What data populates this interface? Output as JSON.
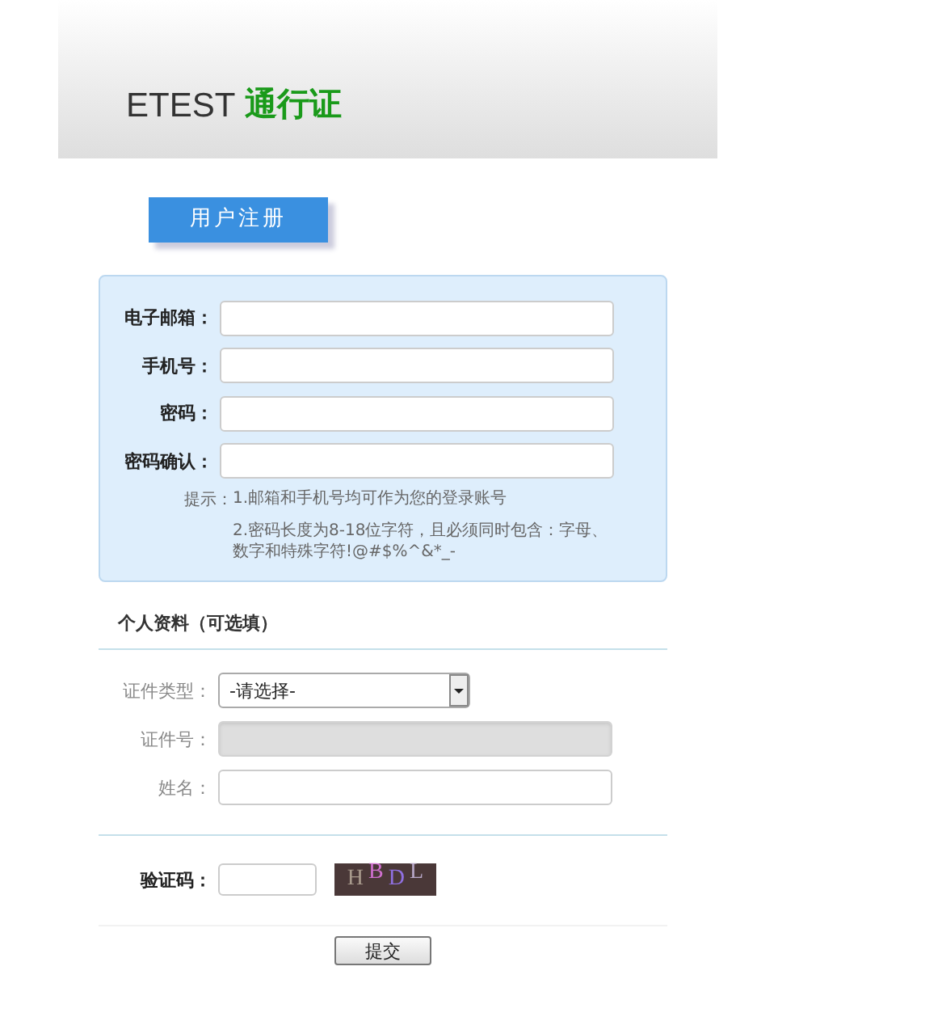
{
  "header": {
    "brand": "ETEST",
    "product": "通行证"
  },
  "tab": {
    "label": "用户注册",
    "selected": true
  },
  "account": {
    "fields": [
      {
        "label": "电子邮箱：",
        "kind": "text",
        "disabled": false
      },
      {
        "label": "手机号：",
        "kind": "text",
        "disabled": false
      },
      {
        "label": "密码：",
        "kind": "text",
        "disabled": false
      },
      {
        "label": "密码确认：",
        "kind": "text",
        "disabled": false
      }
    ],
    "hint_label": "提示：",
    "hints": [
      "1.邮箱和手机号均可作为您的登录账号",
      "2.密码长度为8-18位字符，且必须同时包含：字母、数字和特殊字符!@#$%^&*_-"
    ]
  },
  "profile": {
    "title": "个人资料（可选填）",
    "fields": [
      {
        "label": "证件类型：",
        "kind": "select",
        "value": "-请选择-",
        "disabled": false
      },
      {
        "label": "证件号：",
        "kind": "text",
        "disabled": true
      },
      {
        "label": "姓名：",
        "kind": "text",
        "disabled": false
      }
    ]
  },
  "captcha": {
    "label": "验证码：",
    "letters": [
      {
        "char": "H",
        "color": "#a89a8c"
      },
      {
        "char": "B",
        "color": "#d070d0"
      },
      {
        "char": "D",
        "color": "#9070e0"
      },
      {
        "char": "L",
        "color": "#b8a8c8"
      }
    ]
  },
  "submit": "提交"
}
